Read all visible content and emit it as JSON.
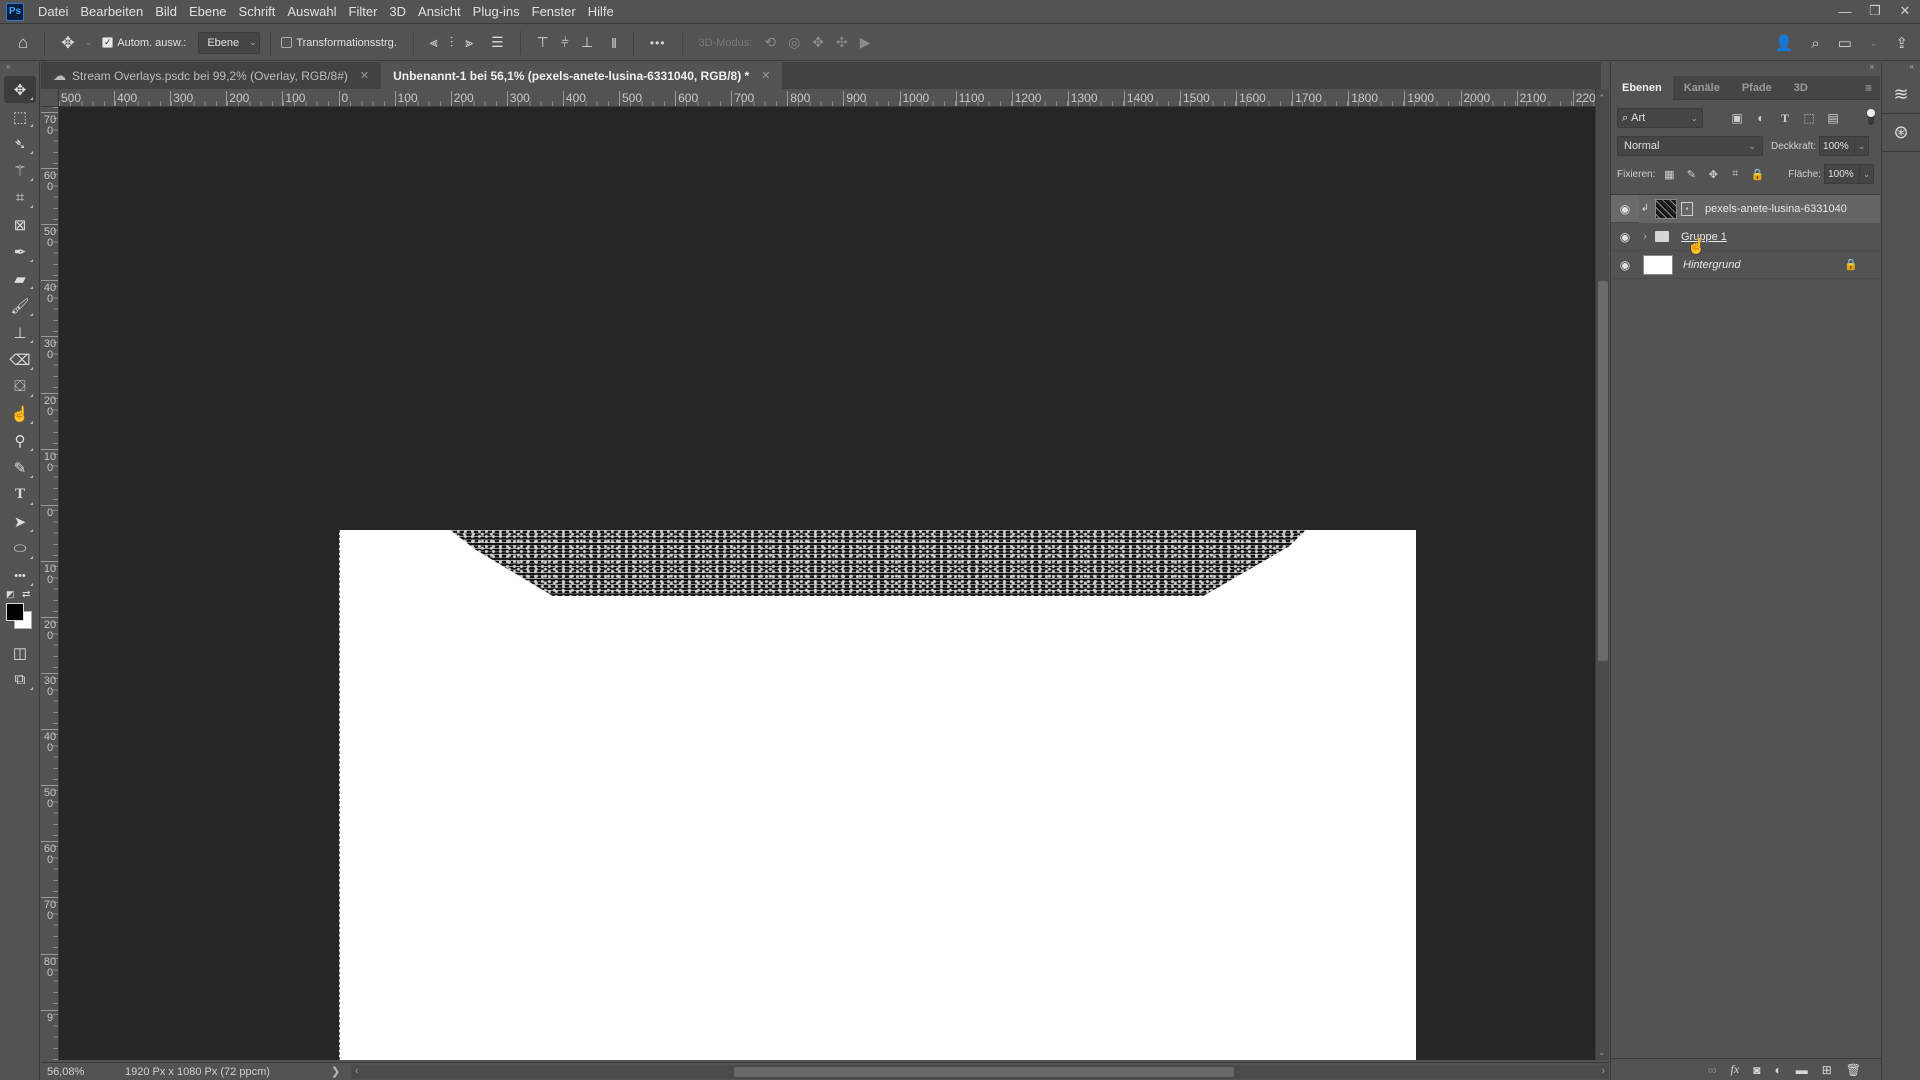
{
  "app": {
    "logo": "Ps"
  },
  "menu": [
    "Datei",
    "Bearbeiten",
    "Bild",
    "Ebene",
    "Schrift",
    "Auswahl",
    "Filter",
    "3D",
    "Ansicht",
    "Plug-ins",
    "Fenster",
    "Hilfe"
  ],
  "window_controls": {
    "minimize": "—",
    "restore": "❐",
    "close": "✕"
  },
  "options": {
    "auto_select_label": "Autom. ausw.:",
    "auto_select_checked": true,
    "auto_select_target": "Ebene",
    "transform_label": "Transformationsstrg.",
    "transform_checked": false,
    "more": "•••",
    "mode_3d_label": "3D-Modus:"
  },
  "tabs": [
    {
      "label": "Stream Overlays.psdc bei 99,2% (Overlay, RGB/8#)",
      "cloud": true,
      "active": false
    },
    {
      "label": "Unbenannt-1 bei 56,1% (pexels-anete-lusina-6331040, RGB/8) *",
      "cloud": false,
      "active": true
    }
  ],
  "ruler_h": [
    "500",
    "400",
    "300",
    "200",
    "100",
    "0",
    "100",
    "200",
    "300",
    "400",
    "500",
    "600",
    "700",
    "800",
    "900",
    "1000",
    "1100",
    "1200",
    "1300",
    "1400",
    "1500",
    "1600",
    "1700",
    "1800",
    "1900",
    "2000",
    "2100",
    "220"
  ],
  "ruler_v": [
    "700",
    "600",
    "500",
    "400",
    "300",
    "200",
    "100",
    "0",
    "100",
    "200",
    "300",
    "400",
    "500",
    "600",
    "700",
    "800",
    "9"
  ],
  "status": {
    "zoom": "56,08%",
    "doc_info": "1920 Px x 1080 Px (72 ppcm)",
    "arrow": "❯"
  },
  "layers_panel": {
    "tabs": [
      "Ebenen",
      "Kanäle",
      "Pfade",
      "3D"
    ],
    "active_tab": "Ebenen",
    "filter_kind": "Art",
    "blend_mode": "Normal",
    "opacity_label": "Deckkraft:",
    "opacity": "100%",
    "lock_label": "Fixieren:",
    "fill_label": "Fläche:",
    "fill": "100%",
    "layers": [
      {
        "name": "pexels-anete-lusina-6331040",
        "type": "smart-object",
        "clipped": true,
        "visible": true,
        "selected": true
      },
      {
        "name": "Gruppe 1",
        "type": "group",
        "visible": true,
        "selected": false
      },
      {
        "name": "Hintergrund",
        "type": "background",
        "locked": true,
        "visible": true,
        "selected": false
      }
    ]
  },
  "icons": {
    "eye": "👁",
    "lock": "🔒"
  }
}
